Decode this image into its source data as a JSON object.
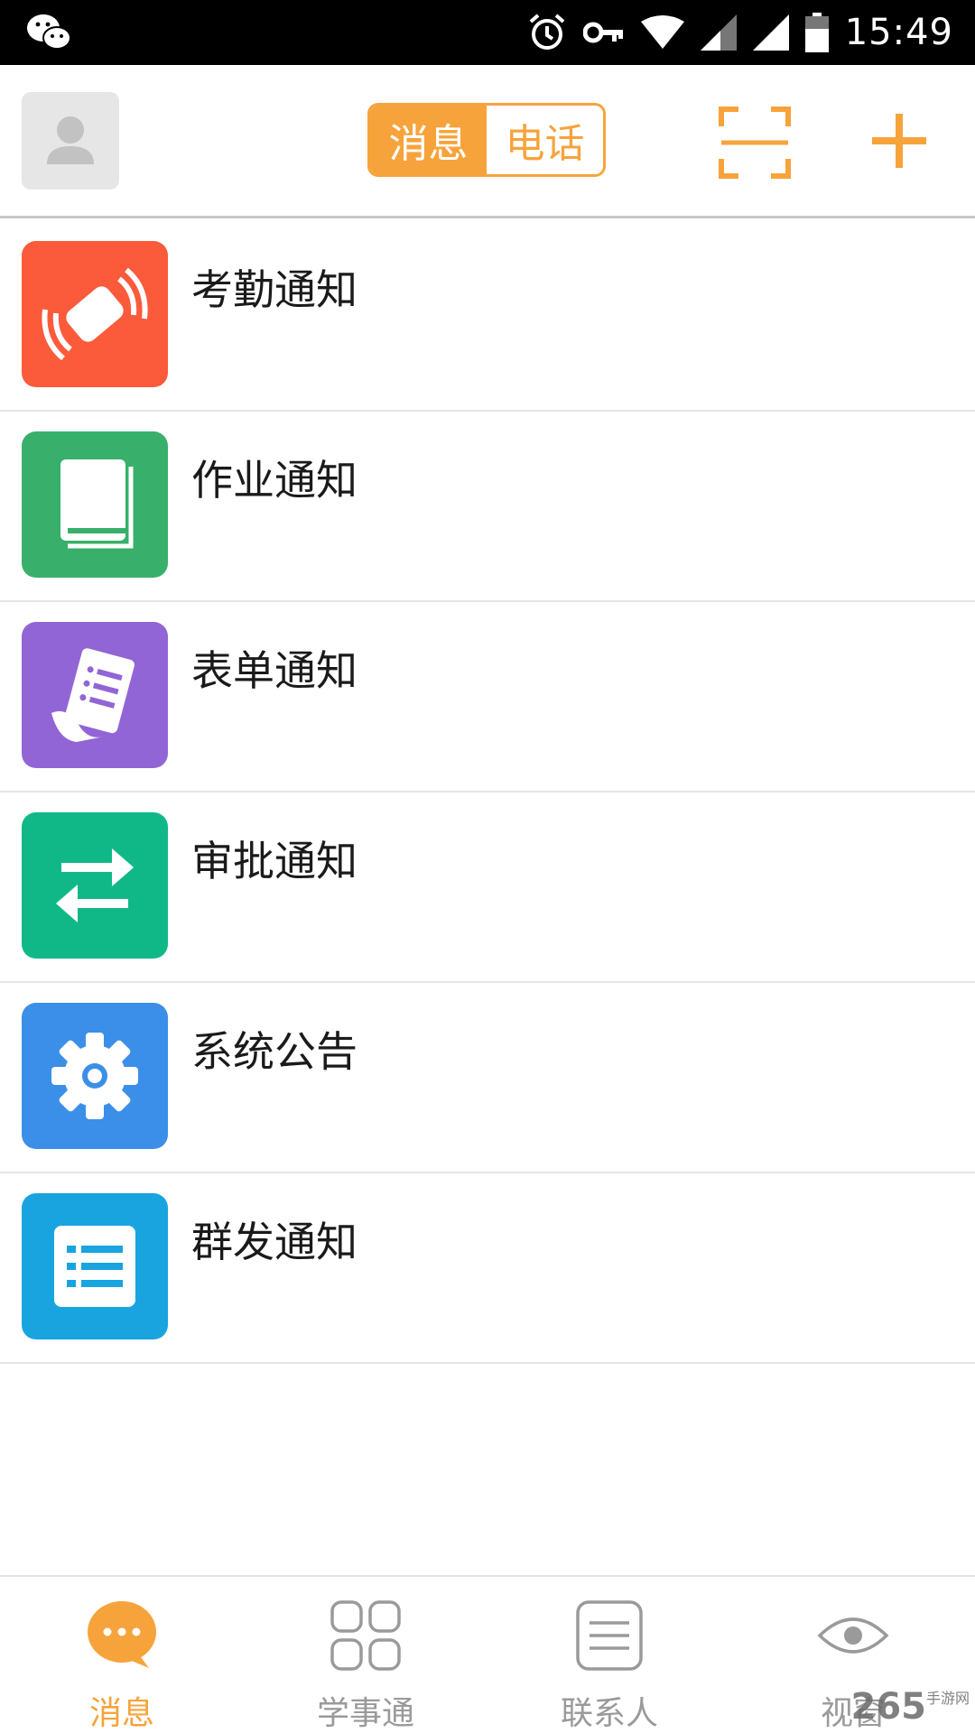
{
  "status_bar": {
    "time": "15:49",
    "icons": [
      "wechat-icon",
      "alarm-icon",
      "vpn-key-icon",
      "wifi-icon",
      "signal-icon",
      "signal-icon",
      "battery-icon"
    ]
  },
  "header": {
    "avatar_icon": "person-icon",
    "tabs": [
      {
        "label": "消息",
        "active": true
      },
      {
        "label": "电话",
        "active": false
      }
    ],
    "scan_icon": "scan-icon",
    "add_icon": "plus-icon",
    "accent_color": "#f7a33b"
  },
  "notifications": [
    {
      "label": "考勤通知",
      "icon": "attendance-card-icon",
      "color": "#fb5a3b"
    },
    {
      "label": "作业通知",
      "icon": "book-icon",
      "color": "#38b06b"
    },
    {
      "label": "表单通知",
      "icon": "form-scroll-icon",
      "color": "#9265d6"
    },
    {
      "label": "审批通知",
      "icon": "swap-arrows-icon",
      "color": "#11b887"
    },
    {
      "label": "系统公告",
      "icon": "gear-icon",
      "color": "#3b8fe8"
    },
    {
      "label": "群发通知",
      "icon": "list-icon",
      "color": "#19a4e0"
    }
  ],
  "bottom_nav": [
    {
      "label": "消息",
      "icon": "chat-bubble-icon",
      "active": true
    },
    {
      "label": "学事通",
      "icon": "apps-grid-icon",
      "active": false
    },
    {
      "label": "联系人",
      "icon": "contacts-list-icon",
      "active": false
    },
    {
      "label": "视窗",
      "icon": "eye-icon",
      "active": false
    }
  ],
  "watermark": {
    "text": "265",
    "sub": "手游网"
  }
}
